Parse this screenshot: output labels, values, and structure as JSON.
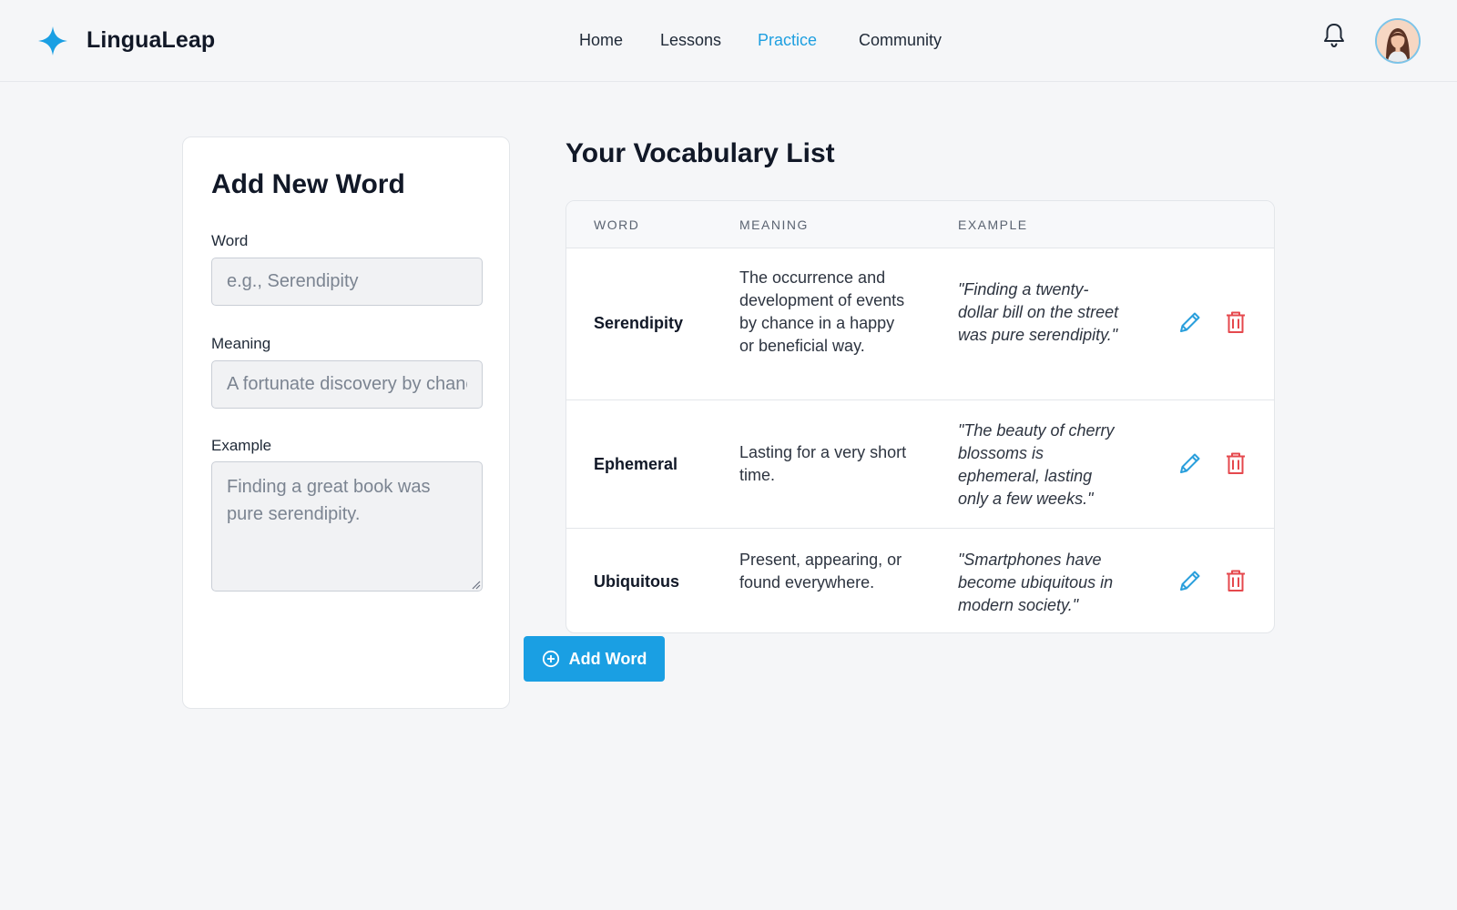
{
  "app": {
    "brand": "LinguaLeap",
    "accent_color": "#1a9fe3",
    "danger_color": "#e5484d"
  },
  "nav": {
    "items": [
      {
        "label": "Home",
        "active": false
      },
      {
        "label": "Lessons",
        "active": false
      },
      {
        "label": "Practice",
        "active": true
      },
      {
        "label": "Community",
        "active": false
      }
    ],
    "notification_icon": "bell-icon",
    "avatar_icon": "user-avatar"
  },
  "add_form": {
    "title": "Add New Word",
    "word_label": "Word",
    "word_placeholder": "e.g., Serendipity",
    "meaning_label": "Meaning",
    "meaning_placeholder": "A fortunate discovery by chance",
    "example_label": "Example",
    "example_placeholder": "Finding a great book was pure serendipity.",
    "submit_label": "Add Word",
    "submit_icon": "plus-circle-icon"
  },
  "vocab": {
    "title": "Your Vocabulary List",
    "columns": [
      "WORD",
      "MEANING",
      "EXAMPLE"
    ],
    "rows": [
      {
        "word": "Serendipity",
        "meaning": "The occurrence and development of events by chance in a happy or beneficial way.",
        "example": "\"Finding a twenty-dollar bill on the street was pure serendipity.\""
      },
      {
        "word": "Ephemeral",
        "meaning": "Lasting for a very short time.",
        "example": "\"The beauty of cherry blossoms is ephemeral, lasting only a few weeks.\""
      },
      {
        "word": "Ubiquitous",
        "meaning": "Present, appearing, or found everywhere.",
        "example": "\"Smartphones have become ubiquitous in modern society.\""
      }
    ],
    "edit_icon": "pencil-icon",
    "delete_icon": "trash-icon"
  }
}
